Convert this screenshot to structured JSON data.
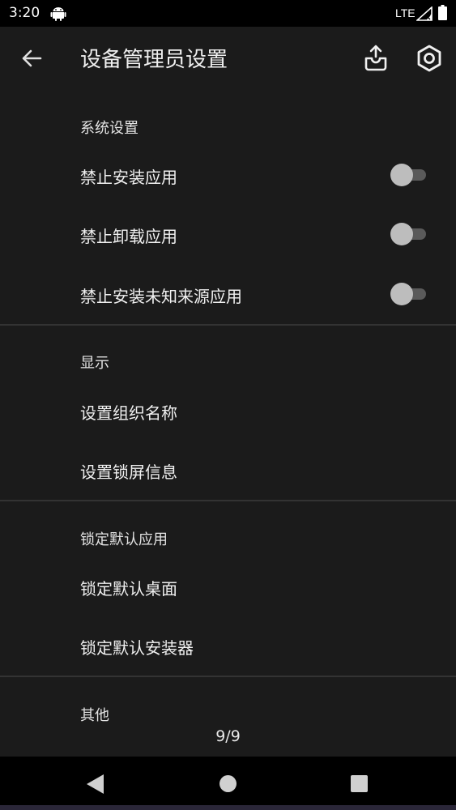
{
  "status_bar": {
    "time": "3:20",
    "network": "LTE",
    "icons": [
      "android-icon",
      "signal-icon",
      "battery-icon"
    ]
  },
  "app_bar": {
    "title": "设备管理员设置",
    "icons": [
      "back-arrow-icon",
      "export-tray-icon",
      "settings-hexagon-icon"
    ]
  },
  "sections": [
    {
      "title": "系统设置",
      "items": [
        {
          "label": "禁止安装应用",
          "toggle": false
        },
        {
          "label": "禁止卸载应用",
          "toggle": false
        },
        {
          "label": "禁止安装未知来源应用",
          "toggle": false
        }
      ]
    },
    {
      "title": "显示",
      "items": [
        {
          "label": "设置组织名称"
        },
        {
          "label": "设置锁屏信息"
        }
      ]
    },
    {
      "title": "锁定默认应用",
      "items": [
        {
          "label": "锁定默认桌面"
        },
        {
          "label": "锁定默认安装器"
        }
      ]
    },
    {
      "title": "其他",
      "items": []
    }
  ],
  "pager": "9/9",
  "colors": {
    "background": "#1b1b1b",
    "toggle_thumb": "#bdbdbd",
    "toggle_track": "#5a5a5a"
  },
  "nav_bar": {
    "icons": [
      "nav-back-icon",
      "nav-home-icon",
      "nav-recents-icon"
    ]
  }
}
